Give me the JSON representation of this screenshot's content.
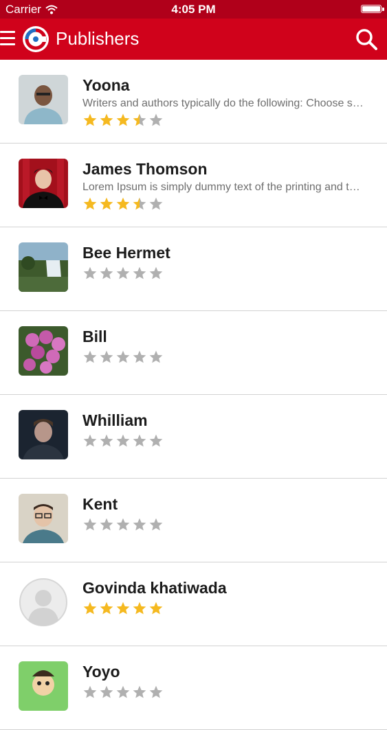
{
  "status_bar": {
    "carrier": "Carrier",
    "time": "4:05 PM"
  },
  "nav": {
    "title": "Publishers"
  },
  "colors": {
    "brand_red": "#d0021b",
    "status_red": "#b0001a",
    "star_gold": "#f5b920",
    "star_gray": "#b0b0b0"
  },
  "publishers": [
    {
      "name": "Yoona",
      "description": "Writers and authors typically do the following: Choose subject matter that interests readers",
      "rating": 3.5,
      "avatar": "man-glasses-photo"
    },
    {
      "name": "James Thomson",
      "description": "Lorem Ipsum is simply dummy text of the printing and typesetting industry",
      "rating": 3.5,
      "avatar": "man-red-backdrop-photo"
    },
    {
      "name": "Bee Hermet",
      "description": "",
      "rating": 0,
      "avatar": "waterfall-photo"
    },
    {
      "name": "Bill",
      "description": "",
      "rating": 0,
      "avatar": "pink-roses-photo"
    },
    {
      "name": "Whilliam",
      "description": "",
      "rating": 0,
      "avatar": "young-man-dark-photo"
    },
    {
      "name": "Kent",
      "description": "",
      "rating": 0,
      "avatar": "man-glasses-portrait-photo"
    },
    {
      "name": "Govinda khatiwada",
      "description": "",
      "rating": 5,
      "avatar": "default-user-placeholder"
    },
    {
      "name": "Yoyo",
      "description": "",
      "rating": 0,
      "avatar": "cartoon-character-photo"
    }
  ]
}
